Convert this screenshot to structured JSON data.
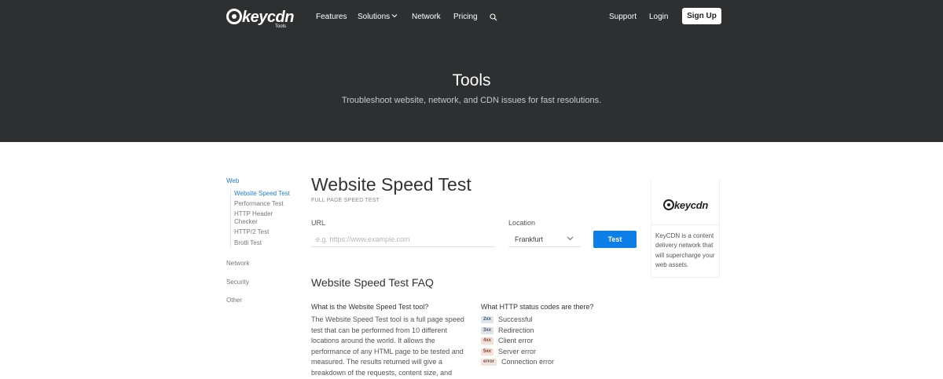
{
  "header": {
    "logo_word": "keycdn",
    "logo_sub": "Tools",
    "nav": [
      "Features",
      "Solutions",
      "Network",
      "Pricing"
    ],
    "right_nav": [
      "Support",
      "Login"
    ],
    "signup_label": "Sign Up"
  },
  "hero": {
    "title": "Tools",
    "subtitle": "Troubleshoot website, network, and CDN issues for fast resolutions."
  },
  "sidebar": {
    "web_label": "Web",
    "web_items": [
      "Website Speed Test",
      "Performance Test",
      "HTTP Header Checker",
      "HTTP/2 Test",
      "Brotli Test"
    ],
    "network_label": "Network",
    "security_label": "Security",
    "other_label": "Other"
  },
  "main": {
    "title": "Website Speed Test",
    "subtitle": "FULL PAGE SPEED TEST",
    "url_label": "URL",
    "url_placeholder": "e.g. https://www.example.com",
    "location_label": "Location",
    "location_value": "Frankfurt",
    "test_label": "Test"
  },
  "faq": {
    "title": "Website Speed Test FAQ",
    "q1": "What is the Website Speed Test tool?",
    "a1": "The Website Speed Test tool is a full page speed test that can be performed from 10 different locations around the world. It allows the performance of any HTML page to be tested and measured. The results returned will give a breakdown of the requests, content size, and",
    "q2": "What HTTP status codes are there?",
    "codes": [
      {
        "code": "2xx",
        "label": "Successful",
        "bg": "#dfe6ec",
        "fg": "#3c5a72"
      },
      {
        "code": "3xx",
        "label": "Redirection",
        "bg": "#dfe3e8",
        "fg": "#4a5868"
      },
      {
        "code": "4xx",
        "label": "Client error",
        "bg": "#f1ded6",
        "fg": "#8b4a2e"
      },
      {
        "code": "5xx",
        "label": "Server error",
        "bg": "#f4e1d8",
        "fg": "#8a3c22"
      },
      {
        "code": "error",
        "label": "Connection error",
        "bg": "#efe5dc",
        "fg": "#7a5540"
      }
    ]
  },
  "ad": {
    "logo_word": "keycdn",
    "text": "KeyCDN is a content delivery network that will supercharge your web assets."
  },
  "colors": {
    "hero_bg": "#2d2f31",
    "accent": "#0d7ee8",
    "link": "#1e7dd8"
  }
}
